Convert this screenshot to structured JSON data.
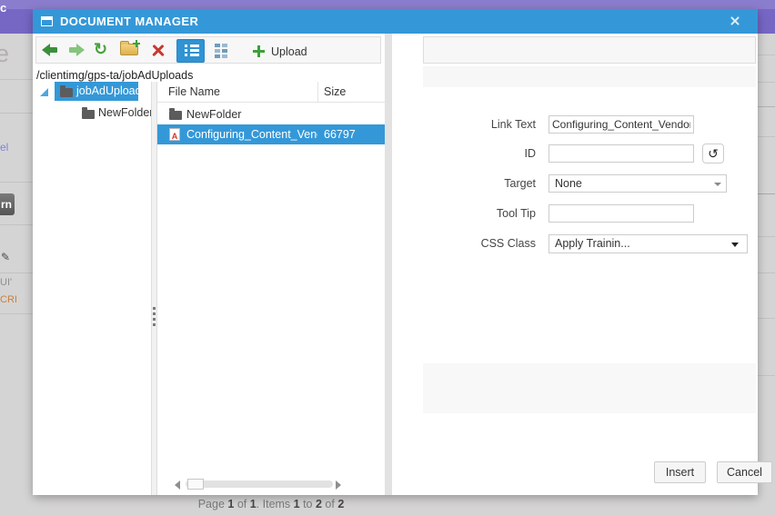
{
  "background": {
    "header_fragment": "fic",
    "heading_fragment": "re",
    "link_fragment": "el",
    "button_fragment": "rn",
    "text_fragment_1": "UI'",
    "text_fragment_2": "CRI"
  },
  "colors": {
    "accent_blue": "#3498d8",
    "header_purple": "#7667c5",
    "upload_green": "#3da03d",
    "delete_red": "#c9392f",
    "pdf_red": "#d0342c"
  },
  "dialog": {
    "title": "DOCUMENT MANAGER",
    "toolbar": {
      "icons": [
        "back-icon",
        "forward-icon",
        "refresh-icon",
        "new-folder-icon",
        "delete-icon",
        "list-view-icon",
        "grid-view-icon",
        "upload-plus-icon"
      ],
      "active_view": "list",
      "upload_label": "Upload"
    },
    "address": "/clientimg/gps-ta/jobAdUploads",
    "tree": {
      "items": [
        {
          "label": "jobAdUploads",
          "selected": true,
          "expanded": true
        },
        {
          "label": "NewFolder",
          "selected": false
        }
      ]
    },
    "file_list": {
      "columns": [
        "File Name",
        "Size"
      ],
      "rows": [
        {
          "name": "NewFolder",
          "size": "",
          "type": "folder",
          "selected": false
        },
        {
          "name": "Configuring_Content_Vendor",
          "size": "66797",
          "type": "pdf",
          "selected": true
        }
      ],
      "pager": {
        "segments": [
          "Page ",
          "1",
          " of ",
          "1",
          ". Items ",
          "1",
          " to ",
          "2",
          " of ",
          "2"
        ]
      }
    },
    "form": {
      "fields": [
        {
          "label": "Link Text",
          "value": "Configuring_Content_Vendor",
          "type": "text"
        },
        {
          "label": "ID",
          "value": "",
          "type": "text-with-refresh"
        },
        {
          "label": "Target",
          "value": "None",
          "type": "select"
        },
        {
          "label": "Tool Tip",
          "value": "",
          "type": "text"
        },
        {
          "label": "CSS Class",
          "value": "Apply Trainin...",
          "type": "select"
        }
      ]
    },
    "footer": {
      "insert_label": "Insert",
      "cancel_label": "Cancel"
    }
  }
}
